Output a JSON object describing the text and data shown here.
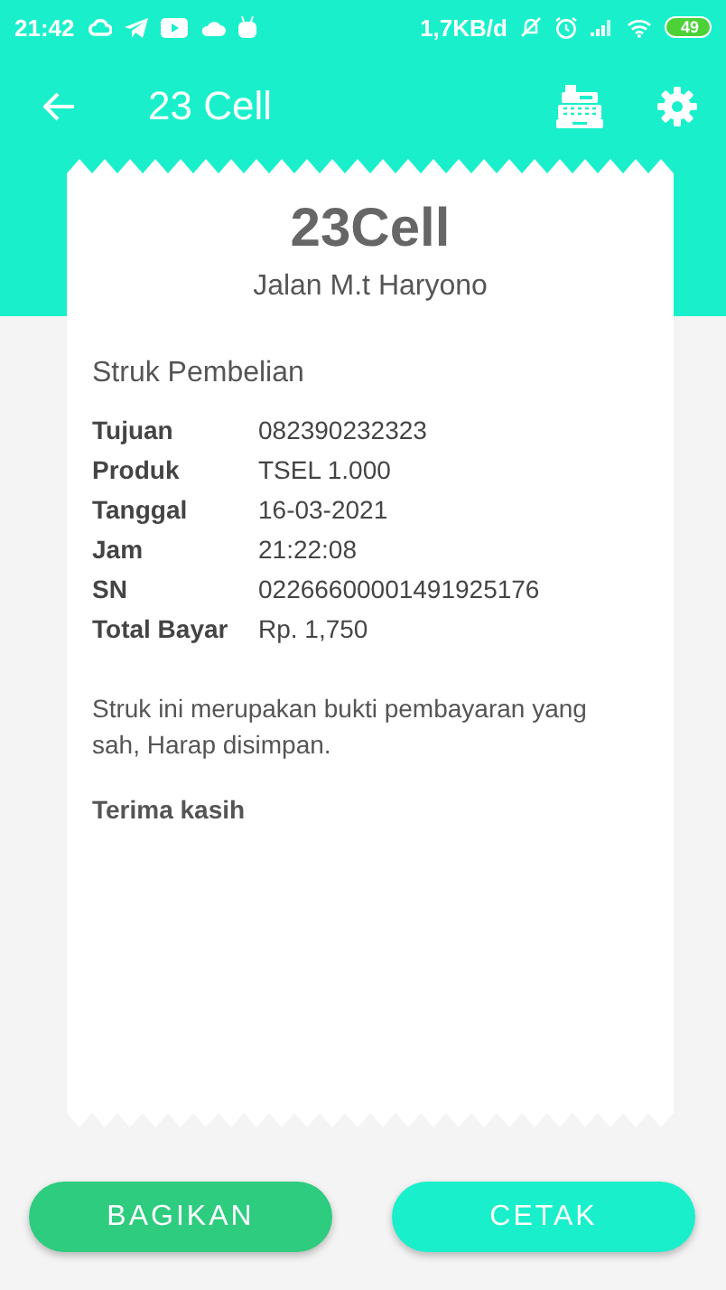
{
  "status_bar": {
    "time": "21:42",
    "network_speed": "1,7KB/d",
    "battery": "49"
  },
  "app_bar": {
    "title": "23 Cell"
  },
  "receipt": {
    "shop_name": "23Cell",
    "address": "Jalan M.t Haryono",
    "heading": "Struk Pembelian",
    "fields": [
      {
        "label": "Tujuan",
        "value": "082390232323"
      },
      {
        "label": "Produk",
        "value": "TSEL 1.000"
      },
      {
        "label": "Tanggal",
        "value": "16-03-2021"
      },
      {
        "label": "Jam",
        "value": "21:22:08"
      },
      {
        "label": "SN",
        "value": "02266600001491925176"
      },
      {
        "label": "Total Bayar",
        "value": "Rp. 1,750"
      }
    ],
    "note": "Struk ini merupakan bukti pembayaran yang sah, Harap disimpan.",
    "thanks": "Terima kasih"
  },
  "buttons": [
    {
      "label": "BAGIKAN",
      "kind": "share"
    },
    {
      "label": "CETAK",
      "kind": "print"
    }
  ]
}
